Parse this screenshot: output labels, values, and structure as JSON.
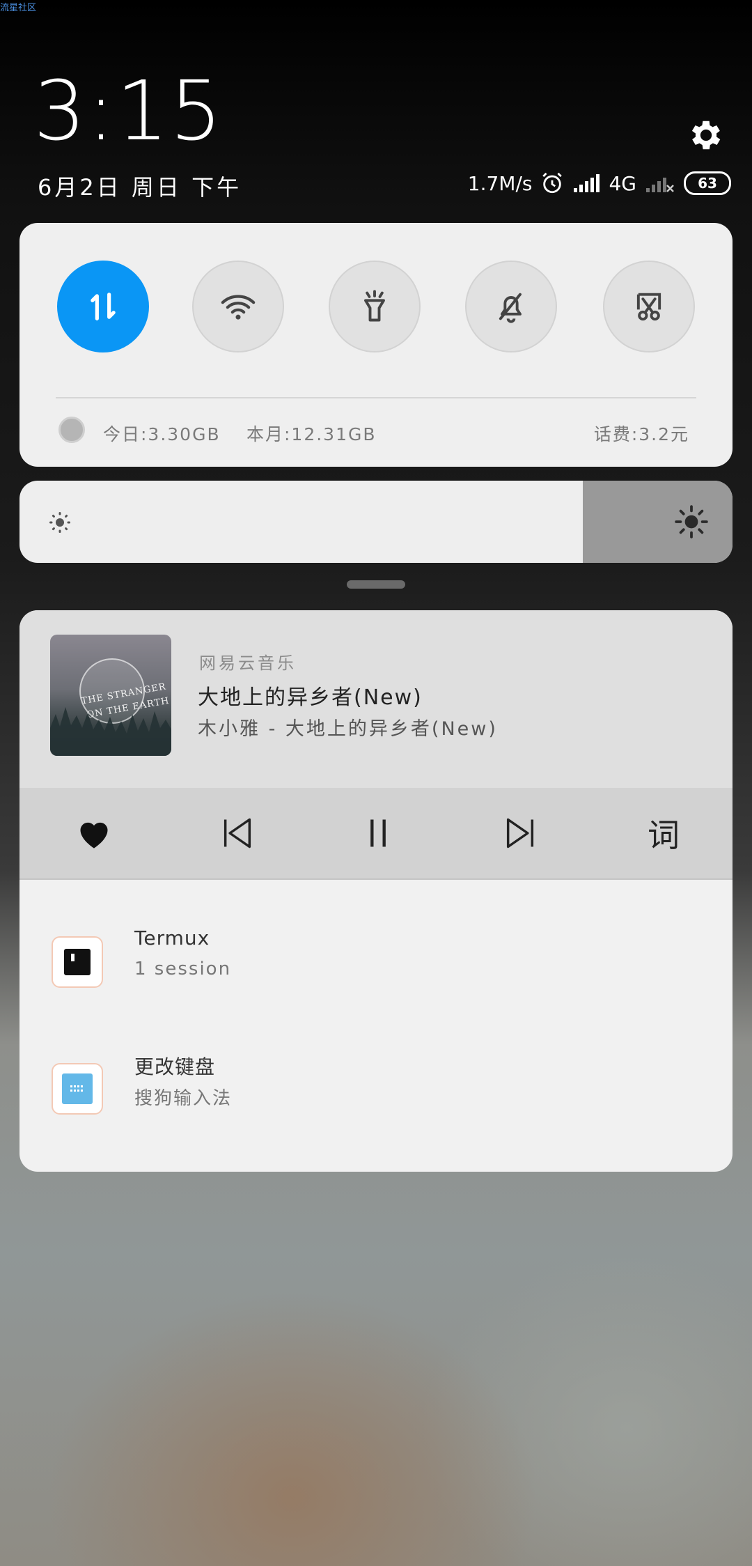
{
  "watermark": "流星社区",
  "clock": {
    "time": "3:15",
    "date": "6月2日 周日 下午"
  },
  "status": {
    "speed": "1.7M/s",
    "network": "4G",
    "battery": "63"
  },
  "quick_settings": {
    "toggles": [
      {
        "name": "mobile-data",
        "icon": "data-arrows-icon",
        "active": true
      },
      {
        "name": "wifi",
        "icon": "wifi-icon",
        "active": false
      },
      {
        "name": "flashlight",
        "icon": "flashlight-icon",
        "active": false
      },
      {
        "name": "mute",
        "icon": "bell-off-icon",
        "active": false
      },
      {
        "name": "screenshot",
        "icon": "scissors-screenshot-icon",
        "active": false
      }
    ],
    "usage_today": "今日:3.30GB",
    "usage_month": "本月:12.31GB",
    "bill": "话费:3.2元"
  },
  "brightness": {
    "level": 0.79
  },
  "media": {
    "app": "网易云音乐",
    "title": "大地上的异乡者(New)",
    "subtitle": "木小雅 - 大地上的异乡者(New)",
    "cover_text_1": "THE STRANGER",
    "cover_text_2": "ON THE EARTH",
    "lyrics_label": "词"
  },
  "notifications": [
    {
      "title": "Termux",
      "subtitle": "1 session"
    },
    {
      "title": "更改键盘",
      "subtitle": "搜狗输入法"
    }
  ],
  "colors": {
    "accent": "#0a96f5"
  }
}
